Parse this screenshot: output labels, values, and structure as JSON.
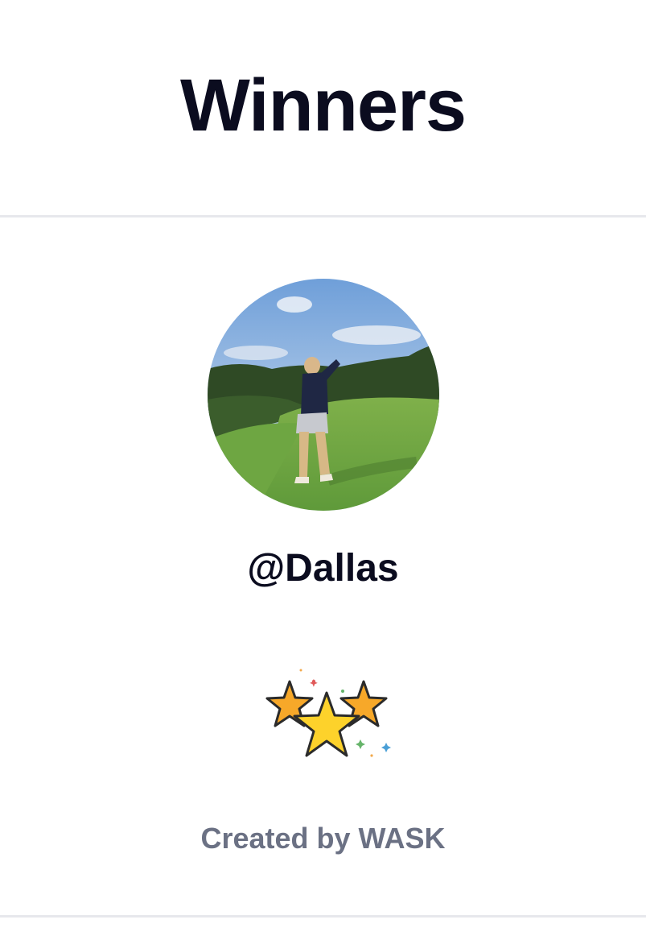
{
  "page": {
    "title": "Winners"
  },
  "winner": {
    "username": "@Dallas",
    "avatar_icon": "golfer-photo-avatar"
  },
  "celebration": {
    "icon": "three-stars-icon",
    "colors": {
      "star_center": "#fdd22b",
      "star_side": "#f7a829",
      "outline": "#2b2b2b"
    }
  },
  "footer": {
    "credit": "Created by WASK"
  },
  "colors": {
    "title": "#0b0c1f",
    "credit": "#6b7184",
    "divider": "#e7e8ec"
  }
}
